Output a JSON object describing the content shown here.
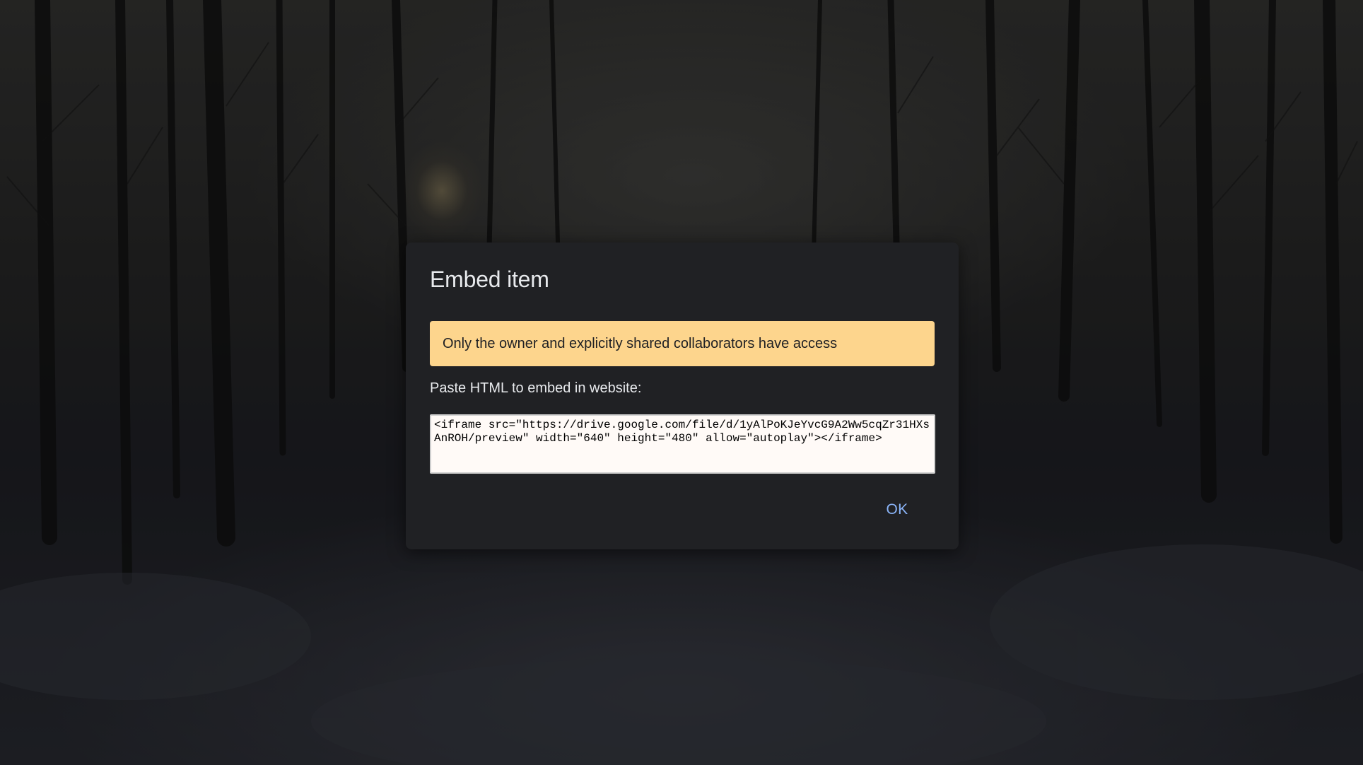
{
  "dialog": {
    "title": "Embed item",
    "warning_text": "Only the owner and explicitly shared collaborators have access",
    "paste_label": "Paste HTML to embed in website:",
    "embed_code": "<iframe src=\"https://drive.google.com/file/d/1yAlPoKJeYvcG9A2Ww5cqZr31HXsAnROH/preview\" width=\"640\" height=\"480\" allow=\"autoplay\"></iframe>",
    "ok_label": "OK"
  },
  "colors": {
    "dialog_background": "#202124",
    "warning_background": "#fdd58d",
    "ok_text": "#8ab4f8",
    "title_text": "#e8eaed"
  }
}
